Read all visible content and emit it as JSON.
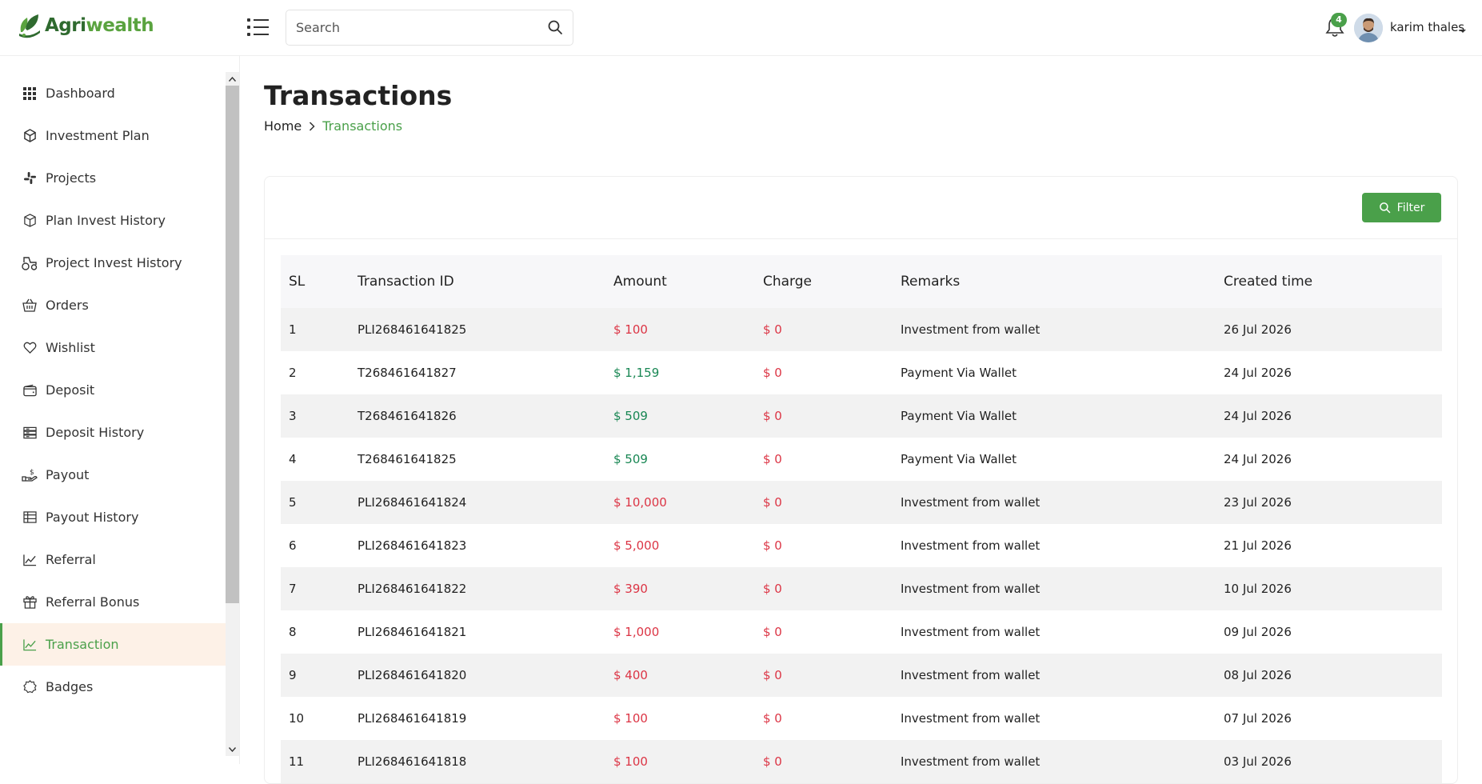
{
  "brand": {
    "part1": "Agri",
    "part2": "wealth"
  },
  "search": {
    "placeholder": "Search"
  },
  "notifications": {
    "count": "4"
  },
  "user": {
    "name": "karim thales"
  },
  "sidebar": {
    "items": [
      {
        "name": "dashboard",
        "label": "Dashboard",
        "icon": "grid-icon"
      },
      {
        "name": "investment-plan",
        "label": "Investment Plan",
        "icon": "cube-icon"
      },
      {
        "name": "projects",
        "label": "Projects",
        "icon": "slack-icon"
      },
      {
        "name": "plan-invest-history",
        "label": "Plan Invest History",
        "icon": "box-icon"
      },
      {
        "name": "project-invest-history",
        "label": "Project Invest History",
        "icon": "tractor-icon"
      },
      {
        "name": "orders",
        "label": "Orders",
        "icon": "basket-icon"
      },
      {
        "name": "wishlist",
        "label": "Wishlist",
        "icon": "heart-icon"
      },
      {
        "name": "deposit",
        "label": "Deposit",
        "icon": "wallet-icon"
      },
      {
        "name": "deposit-history",
        "label": "Deposit History",
        "icon": "server-icon"
      },
      {
        "name": "payout",
        "label": "Payout",
        "icon": "hand-coin-icon"
      },
      {
        "name": "payout-history",
        "label": "Payout History",
        "icon": "table-icon"
      },
      {
        "name": "referral",
        "label": "Referral",
        "icon": "line-chart-icon"
      },
      {
        "name": "referral-bonus",
        "label": "Referral Bonus",
        "icon": "gift-icon"
      },
      {
        "name": "transaction",
        "label": "Transaction",
        "icon": "trend-icon",
        "active": true
      },
      {
        "name": "badges",
        "label": "Badges",
        "icon": "badge-icon"
      }
    ]
  },
  "page": {
    "title": "Transactions",
    "breadcrumb": {
      "home": "Home",
      "current": "Transactions"
    }
  },
  "filter": {
    "label": "Filter"
  },
  "table": {
    "headers": [
      "SL",
      "Transaction ID",
      "Amount",
      "Charge",
      "Remarks",
      "Created time"
    ],
    "rows": [
      {
        "sl": "1",
        "id": "PLI268461641825",
        "amount": "$ 100",
        "amount_type": "neg",
        "charge": "$ 0",
        "remarks": "Investment from wallet",
        "created": "26 Jul 2026"
      },
      {
        "sl": "2",
        "id": "T268461641827",
        "amount": "$ 1,159",
        "amount_type": "pos",
        "charge": "$ 0",
        "remarks": "Payment Via Wallet",
        "created": "24 Jul 2026"
      },
      {
        "sl": "3",
        "id": "T268461641826",
        "amount": "$ 509",
        "amount_type": "pos",
        "charge": "$ 0",
        "remarks": "Payment Via Wallet",
        "created": "24 Jul 2026"
      },
      {
        "sl": "4",
        "id": "T268461641825",
        "amount": "$ 509",
        "amount_type": "pos",
        "charge": "$ 0",
        "remarks": "Payment Via Wallet",
        "created": "24 Jul 2026"
      },
      {
        "sl": "5",
        "id": "PLI268461641824",
        "amount": "$ 10,000",
        "amount_type": "neg",
        "charge": "$ 0",
        "remarks": "Investment from wallet",
        "created": "23 Jul 2026"
      },
      {
        "sl": "6",
        "id": "PLI268461641823",
        "amount": "$ 5,000",
        "amount_type": "neg",
        "charge": "$ 0",
        "remarks": "Investment from wallet",
        "created": "21 Jul 2026"
      },
      {
        "sl": "7",
        "id": "PLI268461641822",
        "amount": "$ 390",
        "amount_type": "neg",
        "charge": "$ 0",
        "remarks": "Investment from wallet",
        "created": "10 Jul 2026"
      },
      {
        "sl": "8",
        "id": "PLI268461641821",
        "amount": "$ 1,000",
        "amount_type": "neg",
        "charge": "$ 0",
        "remarks": "Investment from wallet",
        "created": "09 Jul 2026"
      },
      {
        "sl": "9",
        "id": "PLI268461641820",
        "amount": "$ 400",
        "amount_type": "neg",
        "charge": "$ 0",
        "remarks": "Investment from wallet",
        "created": "08 Jul 2026"
      },
      {
        "sl": "10",
        "id": "PLI268461641819",
        "amount": "$ 100",
        "amount_type": "neg",
        "charge": "$ 0",
        "remarks": "Investment from wallet",
        "created": "07 Jul 2026"
      },
      {
        "sl": "11",
        "id": "PLI268461641818",
        "amount": "$ 100",
        "amount_type": "neg",
        "charge": "$ 0",
        "remarks": "Investment from wallet",
        "created": "03 Jul 2026"
      }
    ]
  },
  "colors": {
    "accent": "#4aa04a",
    "negative": "#dc3545",
    "positive": "#198754",
    "active_bg": "#fdf1e7"
  }
}
